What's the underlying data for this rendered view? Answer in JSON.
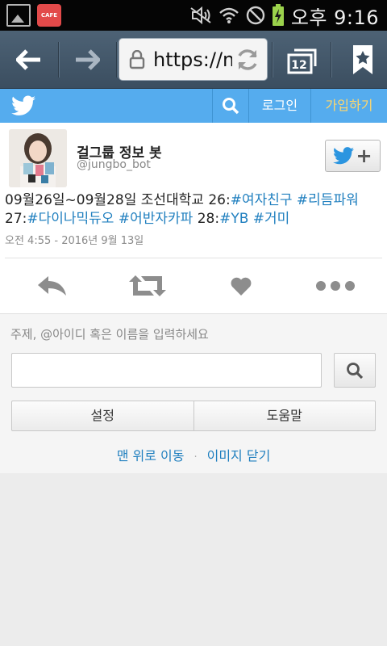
{
  "status_bar": {
    "left_icons": [
      "picture-icon",
      "cafe-app-icon"
    ],
    "cafe_label": "CAFE",
    "right_icons": [
      "mute-icon",
      "wifi-icon",
      "no-signal-icon",
      "battery-charging-icon"
    ],
    "time": "오후 9:16"
  },
  "browser": {
    "url": "https://m",
    "tab_count": "12",
    "icons": [
      "back-arrow-icon",
      "forward-arrow-icon",
      "lock-icon",
      "reload-icon",
      "tabs-icon",
      "bookmark-star-icon"
    ]
  },
  "twitter_header": {
    "login_label": "로그인",
    "signup_label": "가입하기",
    "colors": {
      "bar": "#55acee",
      "signup": "#ffd66b"
    }
  },
  "tweet": {
    "author_name": "걸그룹 정보 봇",
    "author_handle": "@jungbo_bot",
    "text_segments": [
      {
        "text": "09월26일~09월28일 조선대학교 26:",
        "tag": false
      },
      {
        "text": "#여자친구",
        "tag": true
      },
      {
        "text": " ",
        "tag": false
      },
      {
        "text": "#리듬파워",
        "tag": true
      },
      {
        "text": " 27:",
        "tag": false
      },
      {
        "text": "#다이나믹듀오",
        "tag": true
      },
      {
        "text": " ",
        "tag": false
      },
      {
        "text": "#어반자카파",
        "tag": true
      },
      {
        "text": " 28:",
        "tag": false
      },
      {
        "text": "#YB",
        "tag": true
      },
      {
        "text": " ",
        "tag": false
      },
      {
        "text": "#거미",
        "tag": true
      }
    ],
    "timestamp": "오전 4:55 - 2016년 9월 13일",
    "action_icons": [
      "reply-icon",
      "retweet-icon",
      "like-heart-icon",
      "more-dots-icon"
    ],
    "follow_icons": [
      "twitter-bird-icon",
      "plus-icon"
    ],
    "hashtag_color": "#1f7fbf"
  },
  "search_panel": {
    "placeholder_label": "주제, @아이디 혹은 이름을 입력하세요",
    "input_value": "",
    "settings_label": "설정",
    "help_label": "도움말",
    "top_link": "맨 위로 이동",
    "separator": "·",
    "close_images_link": "이미지 닫기"
  }
}
